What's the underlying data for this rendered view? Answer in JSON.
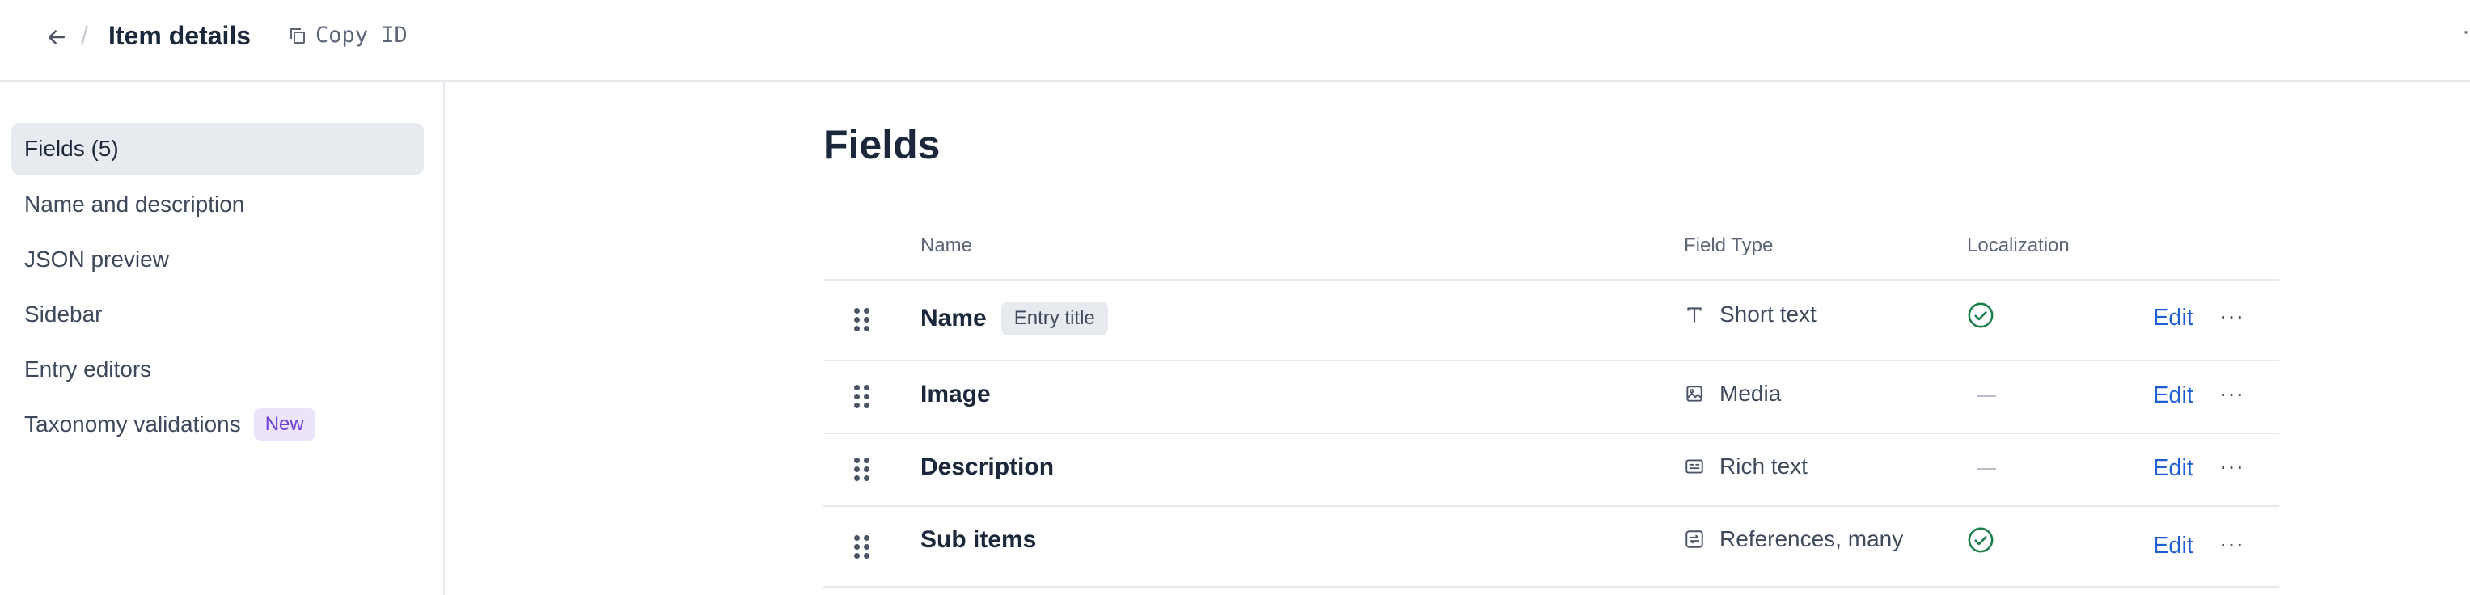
{
  "header": {
    "title": "Item details",
    "copy_id_label": "Copy ID",
    "overflow": "·"
  },
  "sidebar": {
    "items": [
      {
        "label": "Fields (5)",
        "active": true
      },
      {
        "label": "Name and description"
      },
      {
        "label": "JSON preview"
      },
      {
        "label": "Sidebar"
      },
      {
        "label": "Entry editors"
      },
      {
        "label": "Taxonomy validations",
        "badge": "New"
      }
    ]
  },
  "main": {
    "title": "Fields",
    "columns": {
      "name": "Name",
      "type": "Field Type",
      "localization": "Localization"
    },
    "rows": [
      {
        "name": "Name",
        "chip": "Entry title",
        "type": "Short text",
        "type_icon": "text-icon",
        "localized": true,
        "edit": "Edit",
        "more": "···"
      },
      {
        "name": "Image",
        "type": "Media",
        "type_icon": "media-icon",
        "localized": false,
        "edit": "Edit",
        "more": "···"
      },
      {
        "name": "Description",
        "type": "Rich text",
        "type_icon": "rich-text-icon",
        "localized": false,
        "edit": "Edit",
        "more": "···"
      },
      {
        "name": "Sub items",
        "type": "References, many",
        "type_icon": "references-icon",
        "localized": true,
        "edit": "Edit",
        "more": "···"
      }
    ]
  },
  "colors": {
    "accent": "#1f5fd1",
    "success": "#1a7f4b",
    "badge_bg": "#ebe4fb",
    "badge_text": "#6b3fd1"
  }
}
